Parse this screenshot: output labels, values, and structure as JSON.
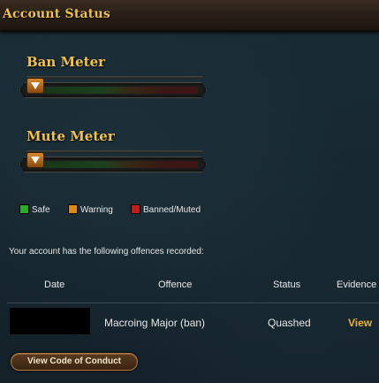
{
  "header": {
    "title": "Account Status"
  },
  "meters": {
    "ban": {
      "label": "Ban Meter",
      "level": 0
    },
    "mute": {
      "label": "Mute Meter",
      "level": 0
    }
  },
  "legend": {
    "safe": {
      "label": "Safe",
      "color": "#22b022"
    },
    "warning": {
      "label": "Warning",
      "color": "#d88a1a"
    },
    "banned": {
      "label": "Banned/Muted",
      "color": "#c81a1a"
    }
  },
  "offences": {
    "intro": "Your account has the following offences recorded:",
    "columns": {
      "date": "Date",
      "offence": "Offence",
      "status": "Status",
      "evidence": "Evidence"
    },
    "rows": [
      {
        "date": "",
        "offence": "Macroing Major (ban)",
        "status": "Quashed",
        "evidence": "View"
      }
    ]
  },
  "actions": {
    "code_of_conduct": "View Code of Conduct"
  }
}
